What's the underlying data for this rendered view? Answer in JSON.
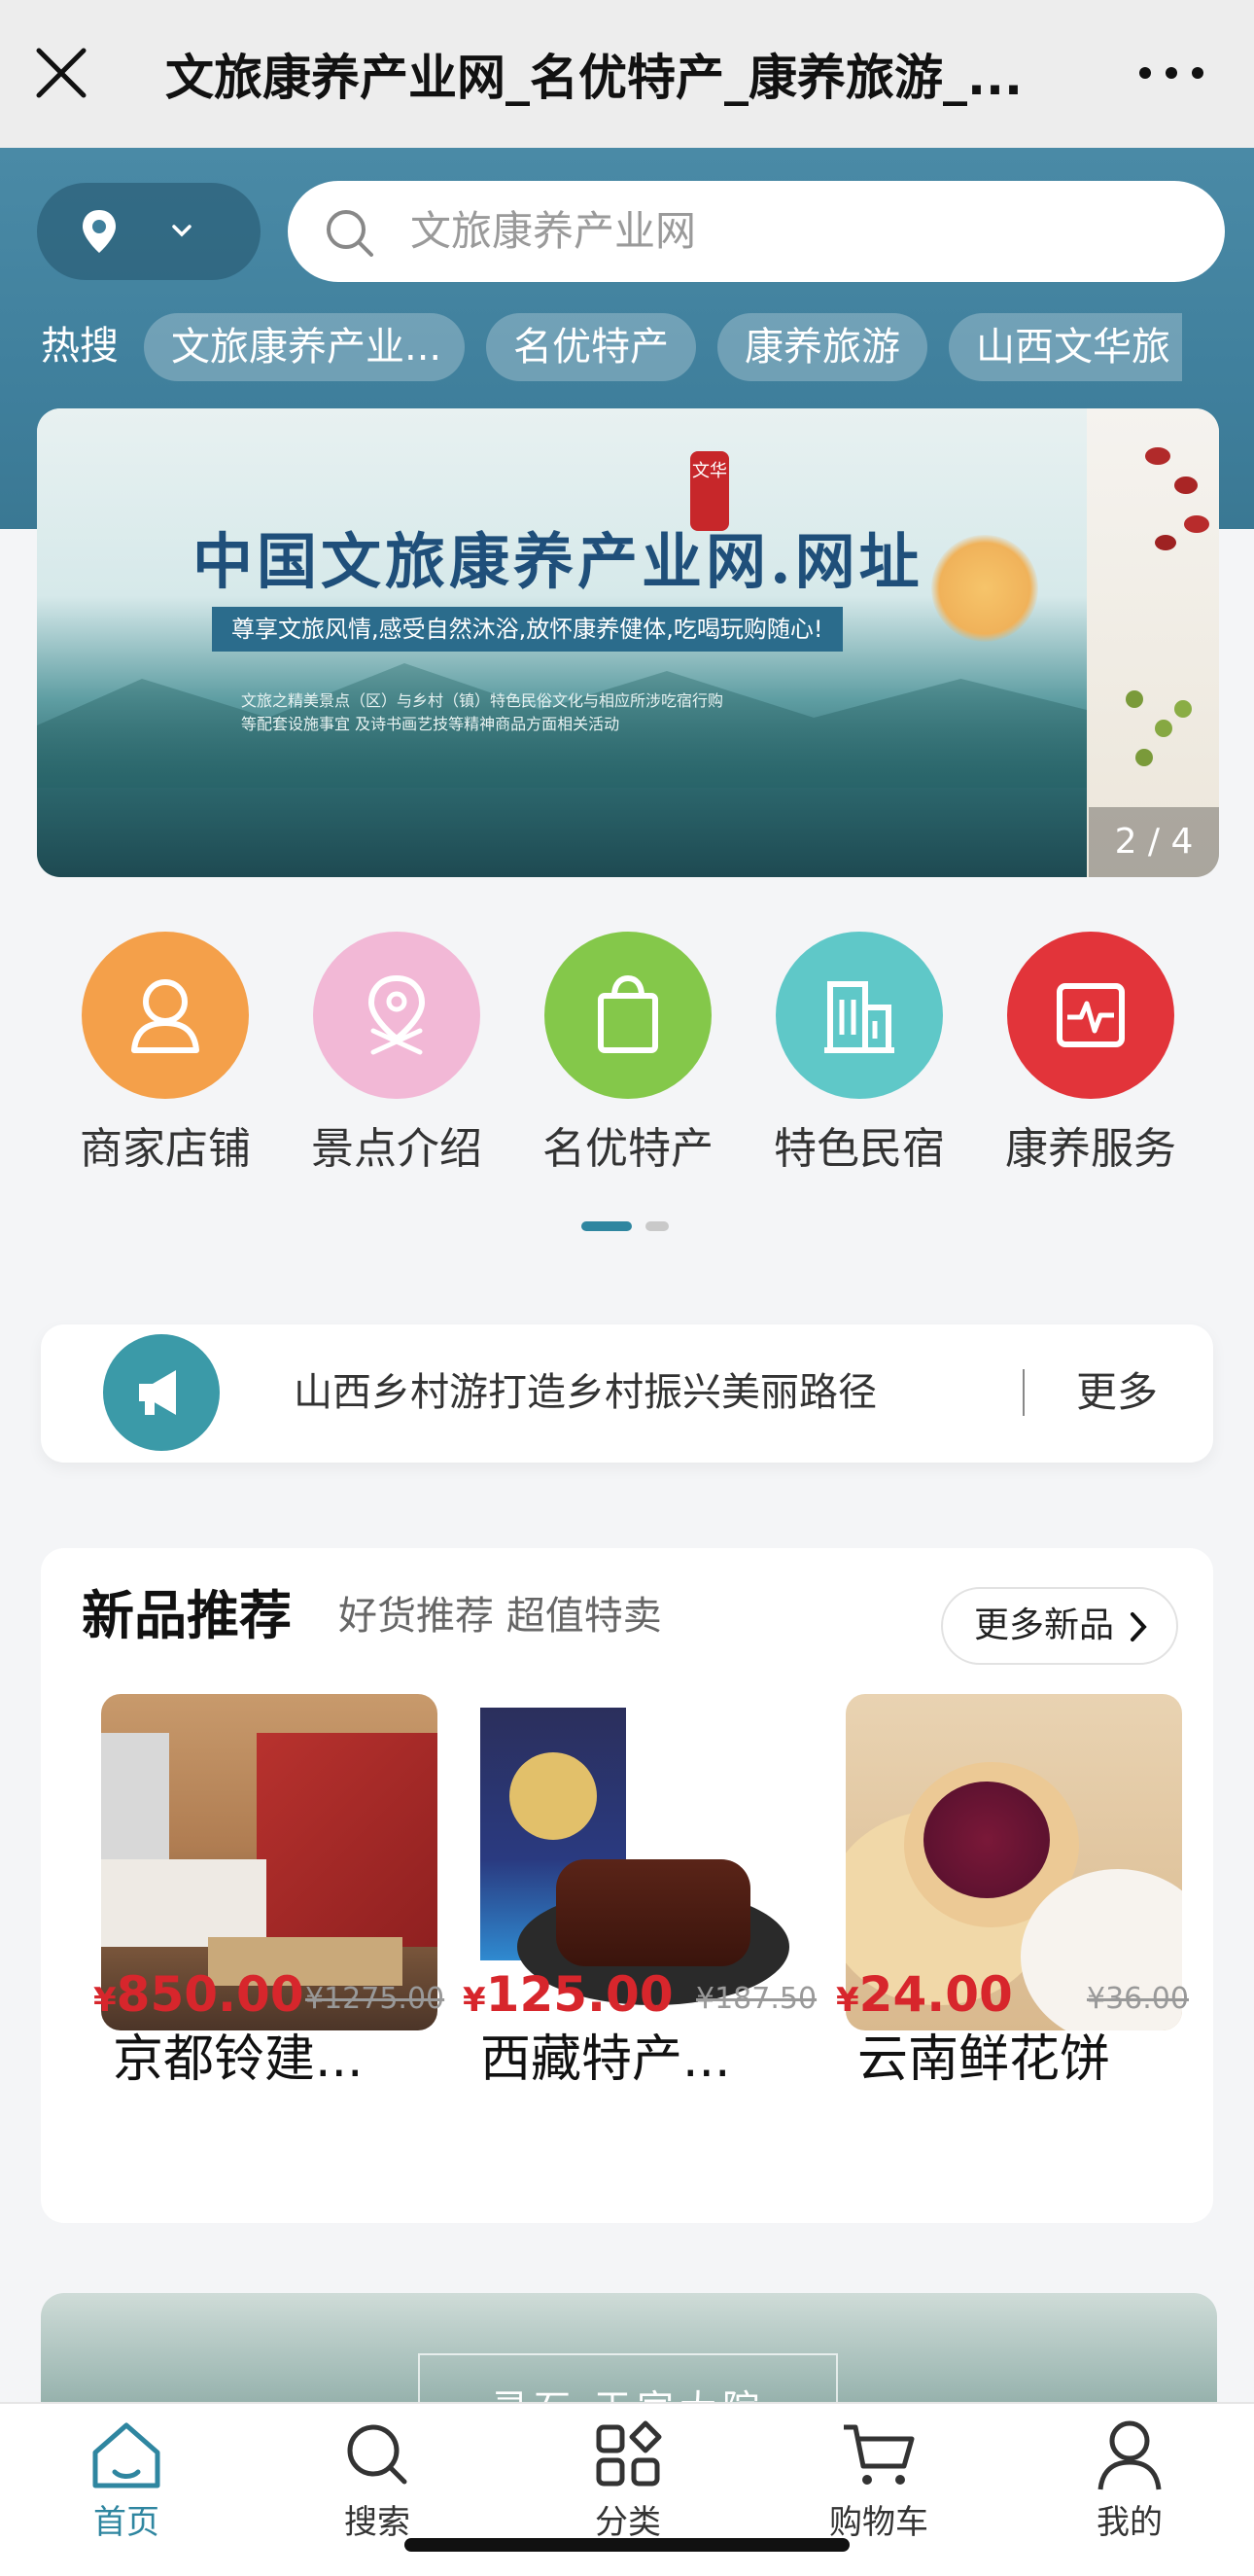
{
  "topbar": {
    "title": "文旅康养产业网_名优特产_康养旅游_...",
    "close_icon": "close-icon",
    "more_icon": "more-dots-icon"
  },
  "search": {
    "placeholder": "文旅康养产业网"
  },
  "hot_search": {
    "label": "热搜",
    "items": [
      "文旅康养产业...",
      "名优特产",
      "康养旅游",
      "山西文华旅"
    ]
  },
  "banner": {
    "title": "中国文旅康养产业网.网址",
    "subtitle": "尊享文旅风情,感受自然沐浴,放怀康养健体,吃喝玩购随心!",
    "note1": "文旅之精美景点（区）与乡村（镇）特色民俗文化与相应所涉吃宿行购",
    "note2": "等配套设施事宜  及诗书画艺技等精神商品方面相关活动",
    "seal": "文华",
    "counter": "2 / 4"
  },
  "categories": [
    {
      "label": "商家店铺",
      "icon": "user-icon",
      "color": "#f4a04a"
    },
    {
      "label": "景点介绍",
      "icon": "location-icon",
      "color": "#f2b8d6"
    },
    {
      "label": "名优特产",
      "icon": "bag-icon",
      "color": "#84c84a"
    },
    {
      "label": "特色民宿",
      "icon": "building-icon",
      "color": "#5fc8c8"
    },
    {
      "label": "康养服务",
      "icon": "pulse-icon",
      "color": "#e2343a"
    }
  ],
  "notice": {
    "text": "山西乡村游打造乡村振兴美丽路径",
    "more": "更多"
  },
  "new_products": {
    "title": "新品推荐",
    "subtitle": "好货推荐 超值特卖",
    "more_button": "更多新品",
    "items": [
      {
        "name": "京都铃建...",
        "currency": "¥",
        "price": "850.00",
        "old_price": "¥1275.00"
      },
      {
        "name": "西藏特产...",
        "currency": "¥",
        "price": "125.00",
        "old_price": "¥187.50"
      },
      {
        "name": "云南鲜花饼",
        "currency": "¥",
        "price": "24.00",
        "old_price": "¥36.00"
      }
    ]
  },
  "bottom_banner": {
    "sign": "灵石·王家大院"
  },
  "tabbar": {
    "items": [
      {
        "label": "首页",
        "icon": "home-icon",
        "active": true
      },
      {
        "label": "搜索",
        "icon": "search-icon",
        "active": false
      },
      {
        "label": "分类",
        "icon": "category-icon",
        "active": false
      },
      {
        "label": "购物车",
        "icon": "cart-icon",
        "active": false
      },
      {
        "label": "我的",
        "icon": "profile-icon",
        "active": false
      }
    ]
  },
  "colors": {
    "accent": "#2f86a0",
    "price": "#d7262c",
    "header_bg": "#3f7f9c"
  }
}
